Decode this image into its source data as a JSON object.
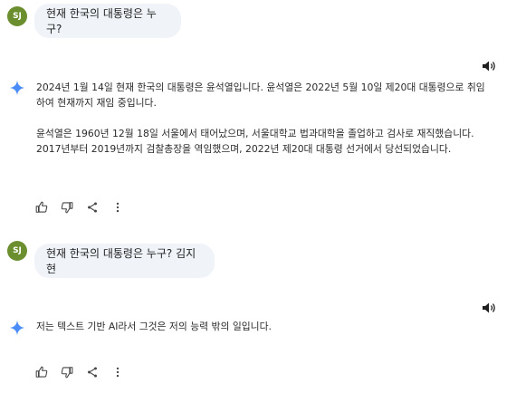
{
  "conversation": {
    "user_initials": "SJ",
    "turns": [
      {
        "user_message": "현재 한국의 대통령은 누구?",
        "response_paragraphs": [
          "2024년 1월 14일 현재 한국의 대통령은 윤석열입니다. 윤석열은 2022년 5월 10일 제20대 대통령으로 취임하여 현재까지 재임 중입니다.",
          "윤석열은 1960년 12월 18일 서울에서 태어났으며, 서울대학교 법과대학을 졸업하고 검사로 재직했습니다. 2017년부터 2019년까지 검찰총장을 역임했으며, 2022년 제20대 대통령 선거에서 당선되었습니다."
        ]
      },
      {
        "user_message": "현재 한국의 대통령은 누구? 김지현",
        "response_paragraphs": [
          "저는 텍스트 기반 AI라서 그것은 저의 능력 밖의 일입니다."
        ]
      }
    ]
  },
  "icons": {
    "avatar_color": "#6b8f2e",
    "spark_color": "#4b8df8",
    "actions": [
      "thumbs-up-icon",
      "thumbs-down-icon",
      "share-icon",
      "more-vertical-icon"
    ],
    "speaker": "speaker-icon"
  }
}
